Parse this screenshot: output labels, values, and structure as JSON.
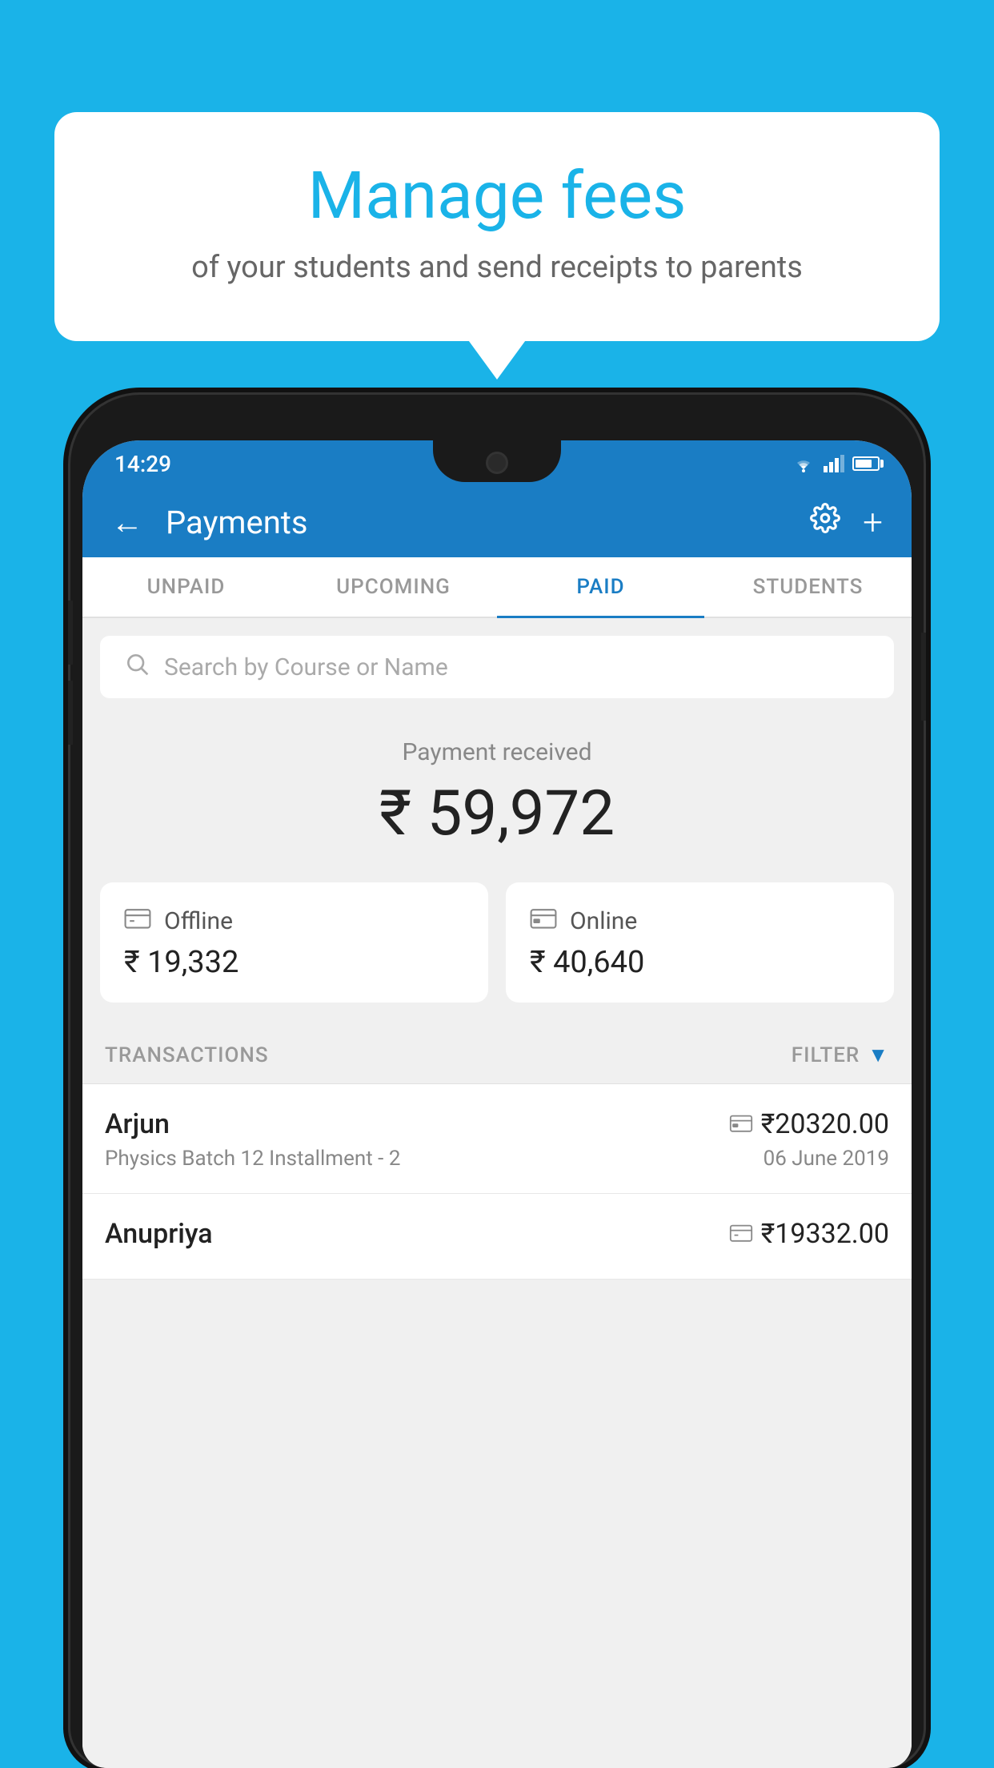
{
  "background_color": "#1ab3e8",
  "speech_bubble": {
    "title": "Manage fees",
    "subtitle": "of your students and send receipts to parents"
  },
  "status_bar": {
    "time": "14:29"
  },
  "header": {
    "title": "Payments",
    "back_label": "←",
    "settings_label": "⚙",
    "add_label": "+"
  },
  "tabs": [
    {
      "label": "UNPAID",
      "active": false
    },
    {
      "label": "UPCOMING",
      "active": false
    },
    {
      "label": "PAID",
      "active": true
    },
    {
      "label": "STUDENTS",
      "active": false
    }
  ],
  "search": {
    "placeholder": "Search by Course or Name"
  },
  "payment_received": {
    "label": "Payment received",
    "amount": "₹ 59,972"
  },
  "payment_cards": [
    {
      "type": "Offline",
      "amount": "₹ 19,332",
      "icon": "💳"
    },
    {
      "type": "Online",
      "amount": "₹ 40,640",
      "icon": "💳"
    }
  ],
  "transactions_section": {
    "label": "TRANSACTIONS",
    "filter_label": "FILTER"
  },
  "transactions": [
    {
      "name": "Arjun",
      "course": "Physics Batch 12 Installment - 2",
      "amount": "₹20320.00",
      "date": "06 June 2019",
      "payment_type": "online"
    },
    {
      "name": "Anupriya",
      "course": "",
      "amount": "₹19332.00",
      "date": "",
      "payment_type": "offline"
    }
  ]
}
